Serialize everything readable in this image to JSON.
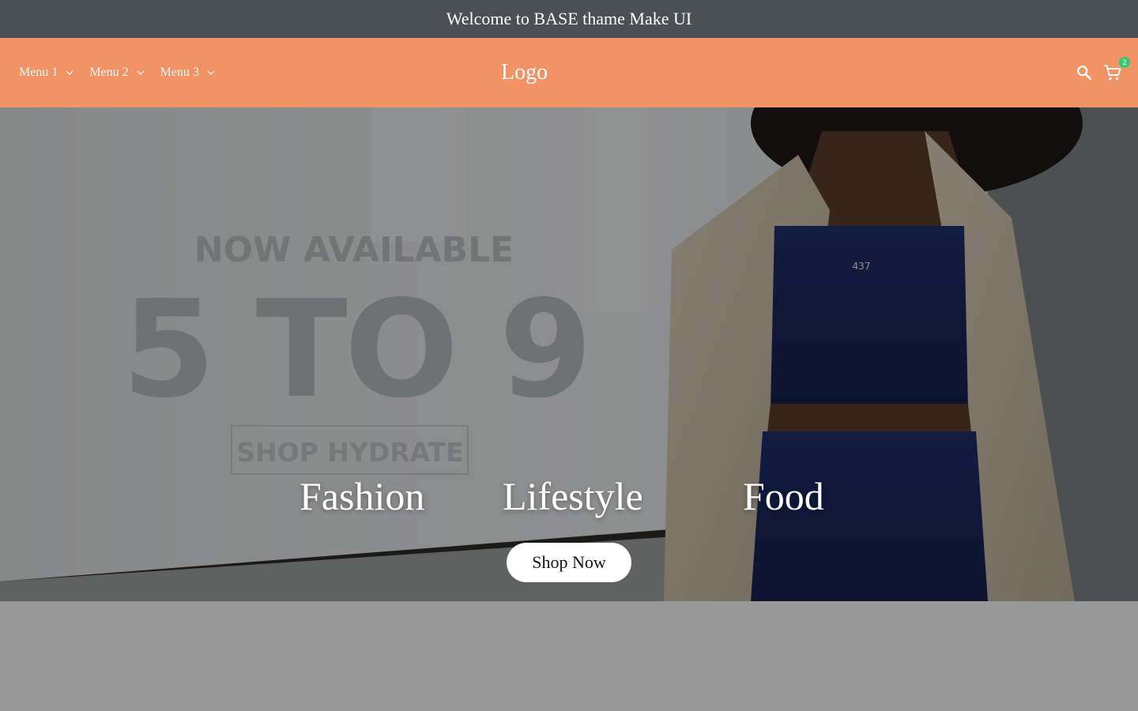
{
  "announcement": {
    "text": "Welcome to BASE thame Make UI"
  },
  "header": {
    "menu": [
      {
        "label": "Menu 1",
        "icon": "chevron-down-icon"
      },
      {
        "label": "Menu 2",
        "icon": "chevron-down-icon"
      },
      {
        "label": "Menu 3",
        "icon": "chevron-down-icon"
      }
    ],
    "logo": "Logo",
    "icons": [
      "search-icon",
      "cart-icon"
    ],
    "cart_count": "2"
  },
  "hero": {
    "background_text": {
      "line1": "NOW AVAILABLE",
      "line2": "5 TO 9",
      "button": "SHOP HYDRATE",
      "shirt": "437"
    },
    "categories": [
      "Fashion",
      "Lifestyle",
      "Food"
    ],
    "cta": "Shop Now"
  },
  "colors": {
    "announcement_bg": "#4a5054",
    "header_bg": "#f29366",
    "badge": "#37c871",
    "page_bg": "#989898"
  }
}
